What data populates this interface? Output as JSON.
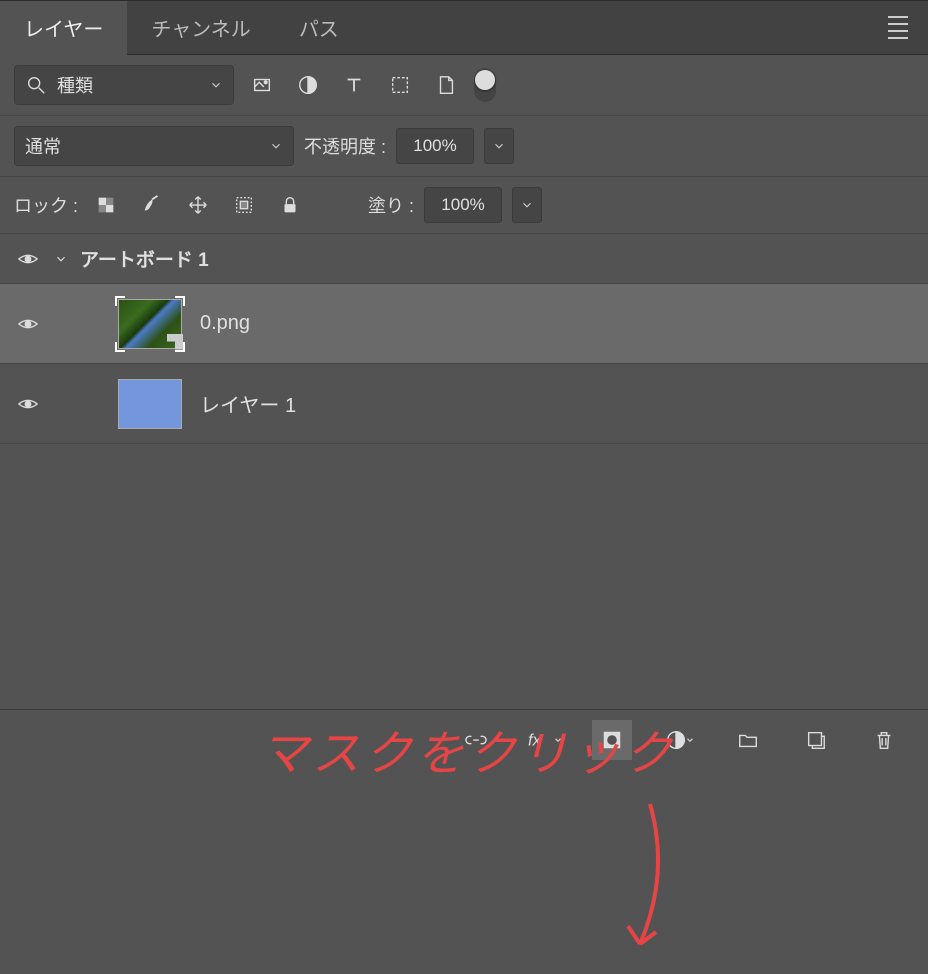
{
  "tabs": {
    "layers": "レイヤー",
    "channels": "チャンネル",
    "paths": "パス"
  },
  "filter": {
    "search_label": "種類"
  },
  "blend": {
    "mode": "通常",
    "opacity_label": "不透明度 :",
    "opacity_value": "100%",
    "fill_label": "塗り :",
    "fill_value": "100%"
  },
  "lock": {
    "label": "ロック :"
  },
  "layers": {
    "artboard": "アートボード 1",
    "items": [
      {
        "name": "0.png"
      },
      {
        "name": "レイヤー 1"
      }
    ]
  },
  "annotation": "マスクをクリック"
}
